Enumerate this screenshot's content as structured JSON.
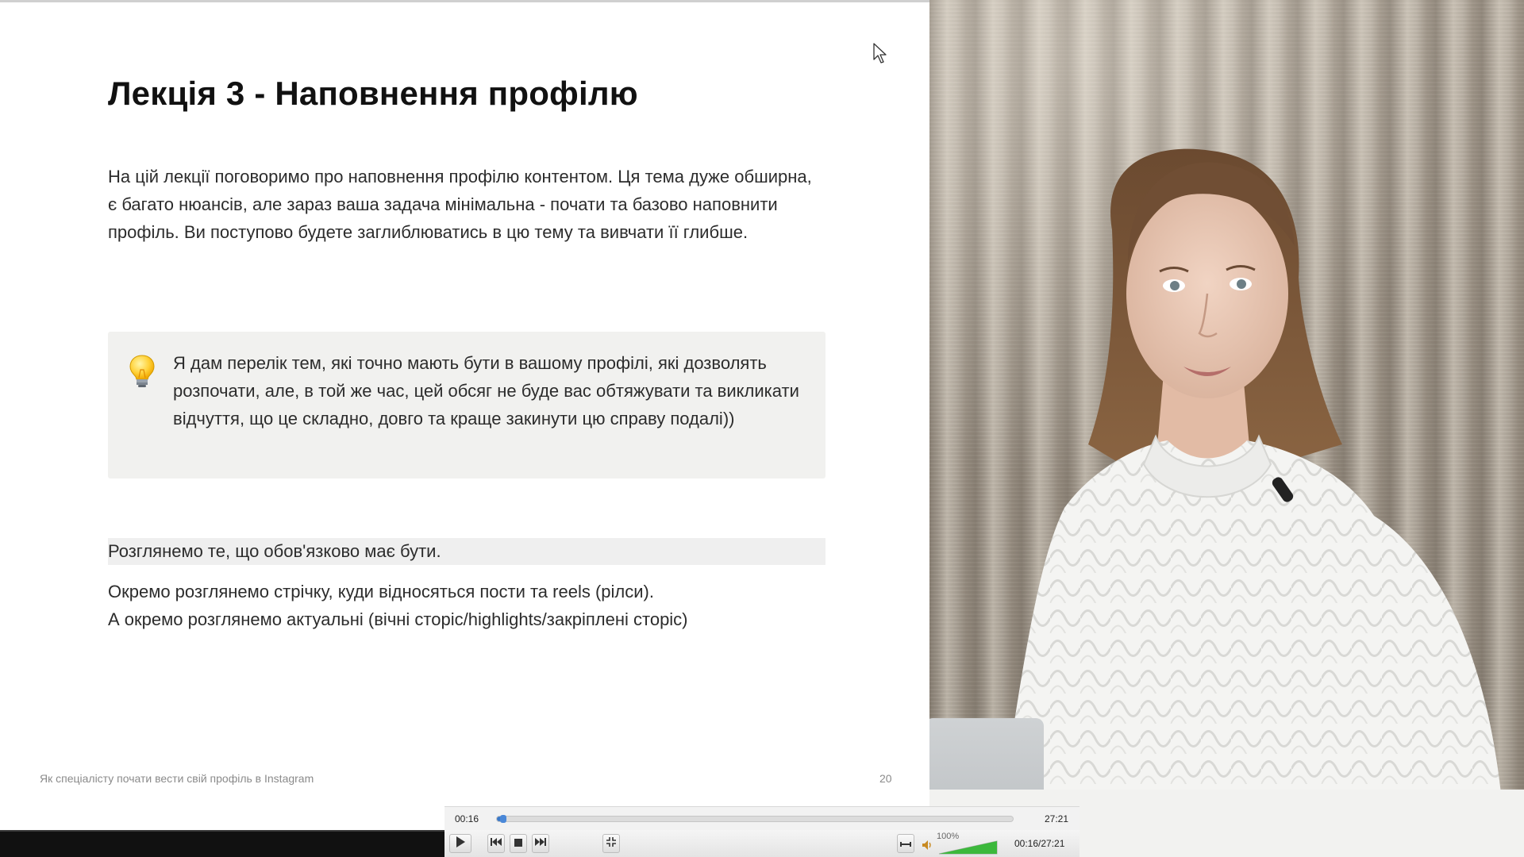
{
  "slide": {
    "title": "Лекція 3 - Наповнення профілю",
    "intro": "На цій лекції поговоримо про наповнення профілю контентом. Ця тема дуже обширна, є багато нюансів, але зараз ваша задача мінімальна - почати та базово наповнити профіль. Ви поступово будете заглиблюватись в цю тему та вивчати її глибше.",
    "callout_icon": "lightbulb-icon",
    "callout_text": "Я дам перелік тем, які точно мають бути в вашому профілі, які дозволять розпочати, але, в той же час, цей обсяг не буде вас обтяжувати та викликати відчуття, що це складно, довго та краще закинути цю справу подалі))",
    "highlight_line": "Розглянемо те, що обов'язково має бути.",
    "line_1": "Окремо розглянемо стрічку, куди відносяться пости та reels (рілси).",
    "line_2": "А окремо розглянемо актуальні (вічні сторіс/highlights/закріплені сторіс)",
    "footer": "Як спеціалісту почати вести свій профіль в Instagram",
    "page_number": "20"
  },
  "player": {
    "elapsed": "00:16",
    "duration": "27:21",
    "progress_fraction": 0.0098,
    "volume_label": "100%",
    "volume_fraction": 1.0,
    "time_combined": "00:16/27:21",
    "colors": {
      "seek": "#3a78c8",
      "volume": "#3cb83c"
    }
  }
}
